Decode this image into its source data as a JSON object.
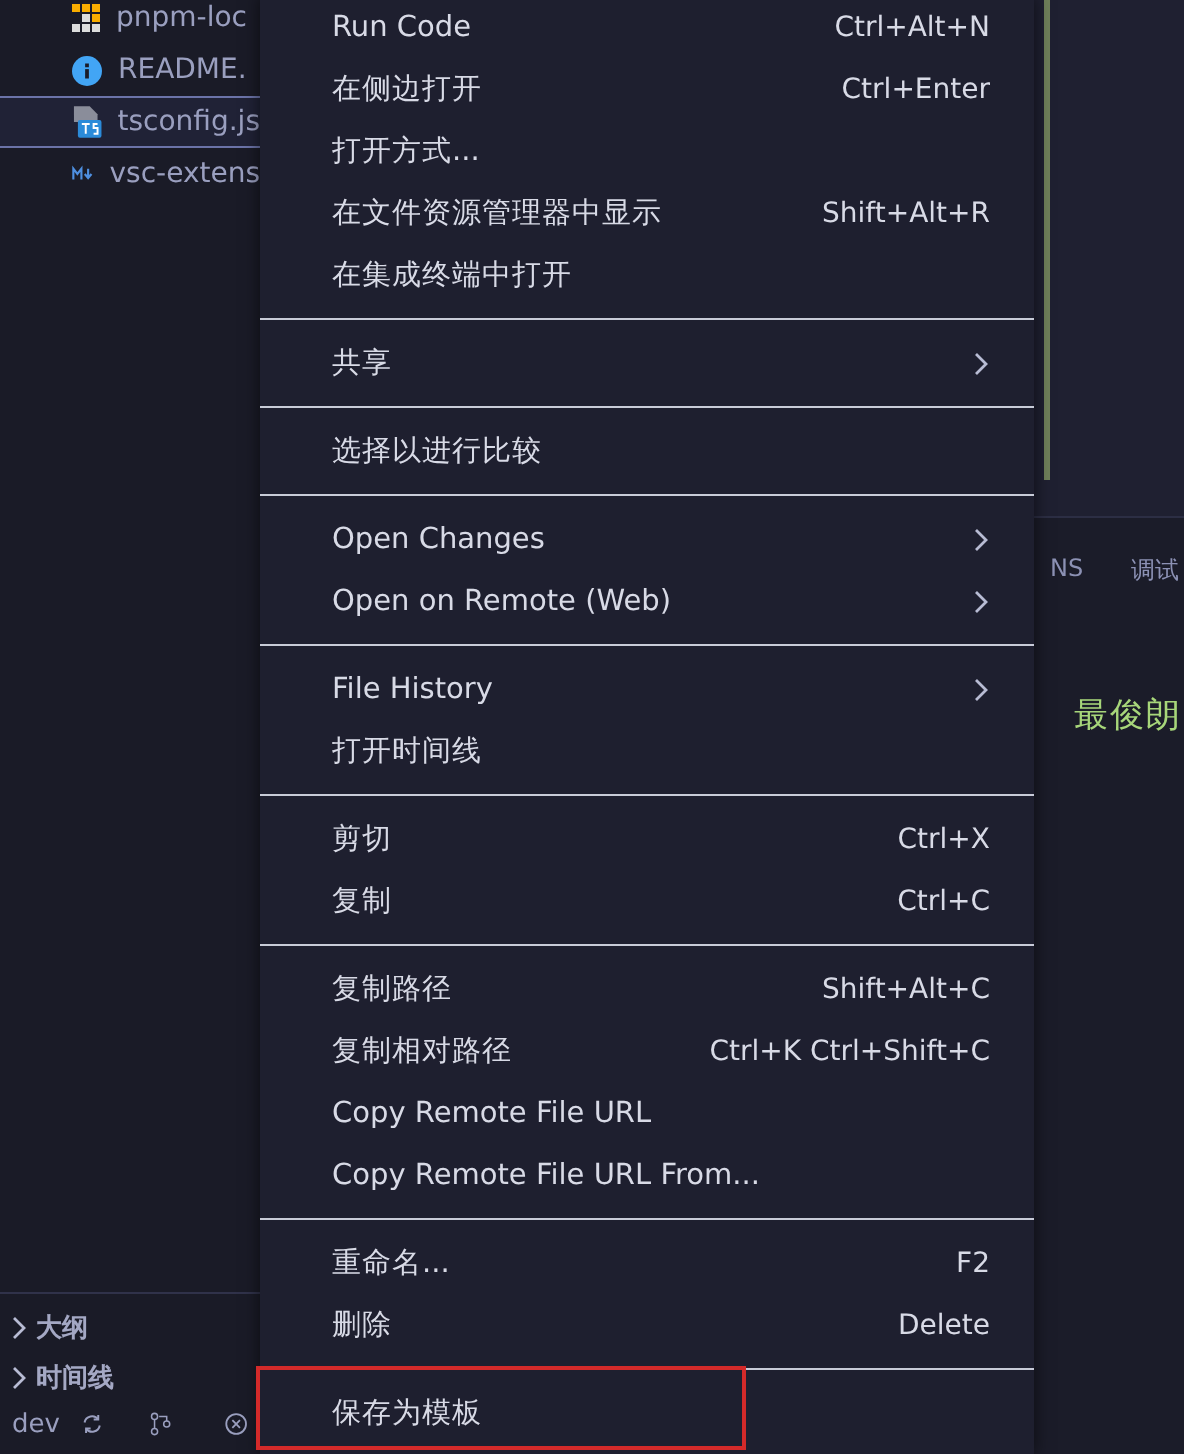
{
  "sidebar": {
    "files": [
      {
        "name": "pnpm-loc",
        "kind": "pnpm",
        "selected": false
      },
      {
        "name": "README.",
        "kind": "info",
        "selected": false
      },
      {
        "name": "tsconfig.js",
        "kind": "typescript",
        "selected": true
      },
      {
        "name": "vsc-extens",
        "kind": "markdown",
        "selected": false
      }
    ],
    "sections": [
      {
        "label": "大纲",
        "expanded": false
      },
      {
        "label": "时间线",
        "expanded": false
      }
    ]
  },
  "status_bar": {
    "branch": "dev"
  },
  "context_menu": {
    "groups": [
      [
        {
          "label": "Run Code",
          "shortcut": "Ctrl+Alt+N"
        },
        {
          "label": "在侧边打开",
          "shortcut": "Ctrl+Enter"
        },
        {
          "label": "打开方式..."
        },
        {
          "label": "在文件资源管理器中显示",
          "shortcut": "Shift+Alt+R"
        },
        {
          "label": "在集成终端中打开"
        }
      ],
      [
        {
          "label": "共享",
          "submenu": true
        }
      ],
      [
        {
          "label": "选择以进行比较"
        }
      ],
      [
        {
          "label": "Open Changes",
          "submenu": true
        },
        {
          "label": "Open on Remote (Web)",
          "submenu": true
        }
      ],
      [
        {
          "label": "File History",
          "submenu": true
        },
        {
          "label": "打开时间线"
        }
      ],
      [
        {
          "label": "剪切",
          "shortcut": "Ctrl+X"
        },
        {
          "label": "复制",
          "shortcut": "Ctrl+C"
        }
      ],
      [
        {
          "label": "复制路径",
          "shortcut": "Shift+Alt+C"
        },
        {
          "label": "复制相对路径",
          "shortcut": "Ctrl+K Ctrl+Shift+C"
        },
        {
          "label": "Copy Remote File URL"
        },
        {
          "label": "Copy Remote File URL From..."
        }
      ],
      [
        {
          "label": "重命名...",
          "shortcut": "F2"
        },
        {
          "label": "删除",
          "shortcut": "Delete"
        }
      ],
      [
        {
          "label": "保存为模板",
          "outlined": true
        }
      ]
    ]
  },
  "panel": {
    "tabs": [
      "NS",
      "调试"
    ],
    "output_text": "最俊朗"
  }
}
